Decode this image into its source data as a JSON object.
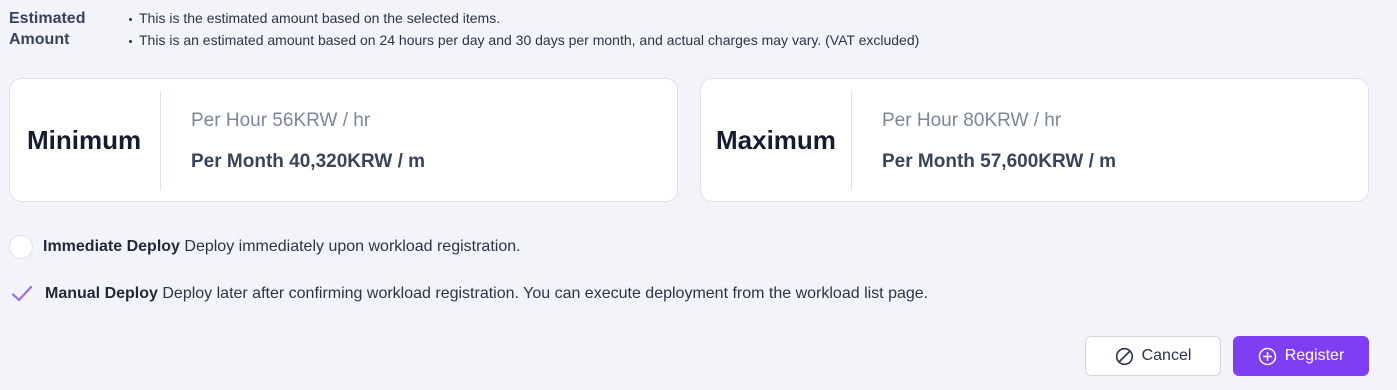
{
  "estimate": {
    "label": "Estimated Amount",
    "notes": [
      "This is the estimated amount based on the selected items.",
      "This is an estimated amount based on 24 hours per day and 30 days per month, and actual charges may vary. (VAT excluded)"
    ]
  },
  "cards": {
    "minimum": {
      "title": "Minimum",
      "per_hour": "Per Hour 56KRW / hr",
      "per_month": "Per Month 40,320KRW / m"
    },
    "maximum": {
      "title": "Maximum",
      "per_hour": "Per Hour 80KRW / hr",
      "per_month": "Per Month 57,600KRW / m"
    }
  },
  "deploy": {
    "immediate": {
      "name": "Immediate Deploy",
      "description": "Deploy immediately upon workload registration.",
      "selected": false
    },
    "manual": {
      "name": "Manual Deploy",
      "description": "Deploy later after confirming workload registration. You can execute deployment from the workload list page.",
      "selected": true
    }
  },
  "buttons": {
    "cancel": "Cancel",
    "register": "Register"
  },
  "colors": {
    "background": "#f2f4f9",
    "accent": "#7e3ff2",
    "check": "#9b6be8"
  },
  "icons": {
    "cancel": "cancel-circle-slash-icon",
    "register": "plus-circle-icon",
    "manual_check": "check-icon"
  }
}
